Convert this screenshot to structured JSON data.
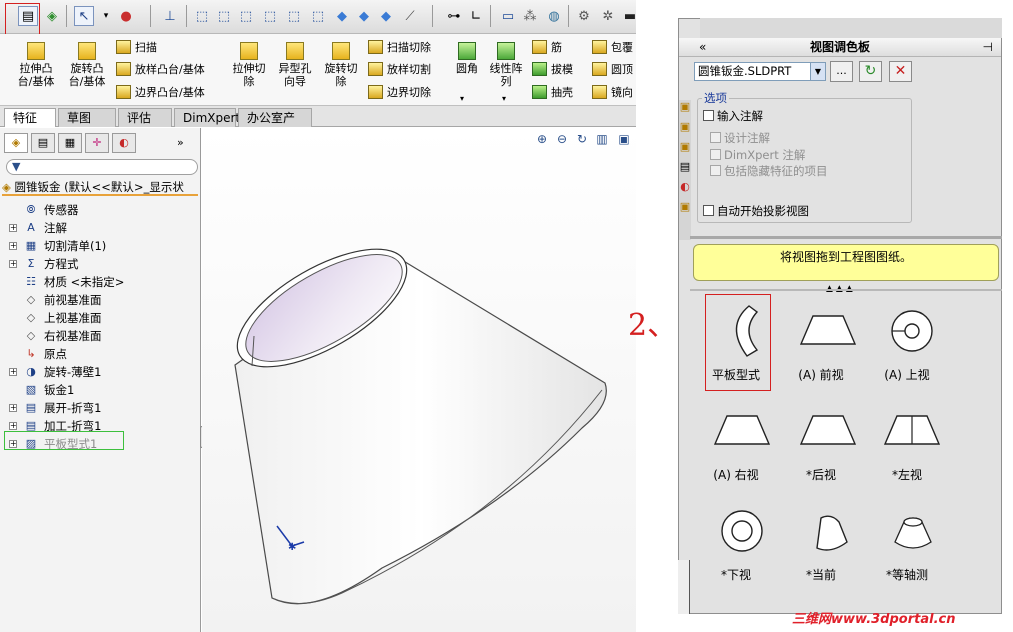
{
  "toolbar": {
    "icons": [
      "new-doc-icon",
      "rebuild-icon",
      "select-arrow-icon",
      "appearance-icon",
      "triad-icon",
      "view-cube-icon",
      "view-cube-icon",
      "view-cube-icon",
      "view-cube-icon",
      "view-cube-icon",
      "view-cube-icon",
      "view-shaded-icon",
      "view-shaded-icon",
      "view-shaded-icon",
      "ruler-icon",
      "measure-icon",
      "angle-icon",
      "monitor-icon",
      "graph-icon",
      "globe-icon",
      "settings-gear-icon",
      "settings-icon"
    ]
  },
  "ribbon": {
    "extrude_boss": "拉伸凸\n台/基体",
    "revolve_boss": "旋转凸\n台/基体",
    "sweep": "扫描",
    "loft_boss": "放样凸台/基体",
    "boundary_boss": "边界凸台/基体",
    "extrude_cut": "拉伸切\n除",
    "hole_wizard": "异型孔\n向导",
    "revolve_cut": "旋转切\n除",
    "sweep_cut": "扫描切除",
    "loft_cut": "放样切割",
    "boundary_cut": "边界切除",
    "fillet": "圆角",
    "linear_pattern": "线性阵\n列",
    "rib": "筋",
    "draft": "拔模",
    "shell": "抽壳",
    "wrap": "包覆",
    "dome": "圆顶",
    "mirror": "镜向"
  },
  "tabs": [
    "特征",
    "草图",
    "评估",
    "DimXpert",
    "办公室产品"
  ],
  "tree": {
    "root": "圆锥钣金  (默认<<默认>_显示状",
    "items": [
      {
        "label": "传感器",
        "expand": false,
        "icon": "sensor-icon"
      },
      {
        "label": "注解",
        "expand": true,
        "icon": "annotation-icon"
      },
      {
        "label": "切割清单(1)",
        "expand": true,
        "icon": "cut-list-icon"
      },
      {
        "label": "方程式",
        "expand": true,
        "icon": "equation-icon"
      },
      {
        "label": "材质 <未指定>",
        "expand": false,
        "icon": "material-icon"
      },
      {
        "label": "前视基准面",
        "expand": false,
        "icon": "plane-icon"
      },
      {
        "label": "上视基准面",
        "expand": false,
        "icon": "plane-icon"
      },
      {
        "label": "右视基准面",
        "expand": false,
        "icon": "plane-icon"
      },
      {
        "label": "原点",
        "expand": false,
        "icon": "origin-icon"
      },
      {
        "label": "旋转-薄壁1",
        "expand": true,
        "icon": "revolve-feature-icon"
      },
      {
        "label": "钣金1",
        "expand": false,
        "icon": "sheet-metal-icon"
      },
      {
        "label": "展开-折弯1",
        "expand": true,
        "icon": "unfold-icon"
      },
      {
        "label": "加工-折弯1",
        "expand": true,
        "icon": "process-bend-icon"
      },
      {
        "label": "平板型式1",
        "expand": true,
        "icon": "flat-pattern-icon"
      }
    ]
  },
  "annotation_step": "2、",
  "panel": {
    "title": "视图调色板",
    "file_select": "圆锥钣金.SLDPRT",
    "browse_label": "...",
    "options_group": "选项",
    "options": [
      {
        "label": "输入注解",
        "enabled": true
      },
      {
        "label": "设计注解",
        "enabled": false
      },
      {
        "label": "DimXpert 注解",
        "enabled": false
      },
      {
        "label": "包括隐藏特征的项目",
        "enabled": false
      }
    ],
    "auto_project": "自动开始投影视图",
    "hint": "将视图拖到工程图图纸。",
    "views": [
      {
        "label": "平板型式"
      },
      {
        "label": "(A) 前视"
      },
      {
        "label": "(A) 上视"
      },
      {
        "label": "(A) 右视"
      },
      {
        "label": "*后视"
      },
      {
        "label": "*左视"
      },
      {
        "label": "*下视"
      },
      {
        "label": "*当前"
      },
      {
        "label": "*等轴测"
      }
    ]
  },
  "watermark": "三维网www.3dportal.cn",
  "colors": {
    "highlight_red": "#d42020",
    "hint_yellow": "#ffff99",
    "tree_highlight_green": "#3cbf3c",
    "watermark_red": "#e0202a"
  }
}
